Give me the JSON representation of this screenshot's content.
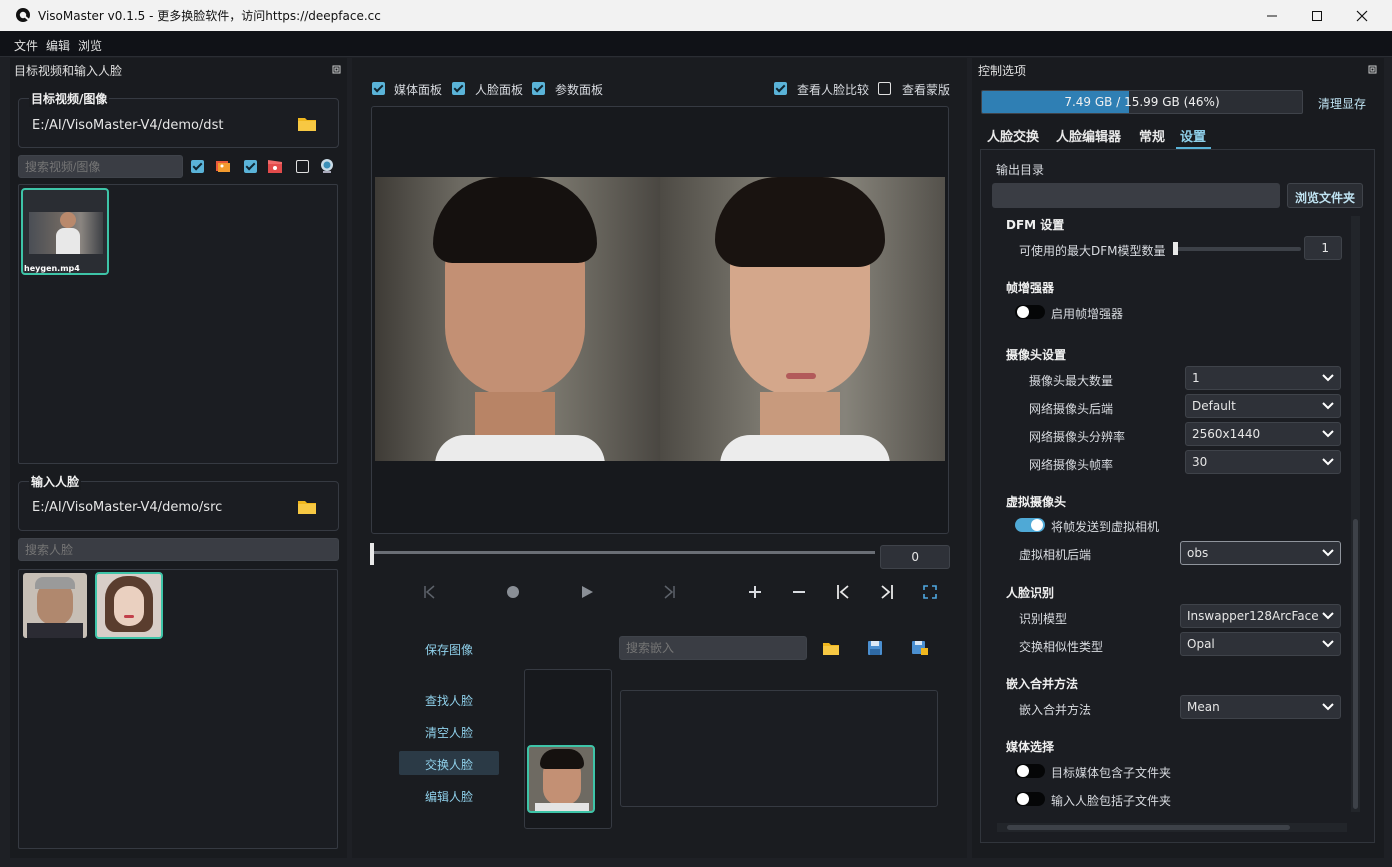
{
  "window": {
    "title": "VisoMaster v0.1.5 - 更多换脸软件，访问https://deepface.cc"
  },
  "menu": [
    "文件",
    "编辑",
    "浏览"
  ],
  "left_panel": {
    "header": "目标视频和输入人脸",
    "target": {
      "group_title": "目标视频/图像",
      "path": "E:/AI/VisoMaster-V4/demo/dst",
      "search_placeholder": "搜索视频/图像",
      "thumbs": [
        {
          "label": "heygen.mp4"
        }
      ]
    },
    "input": {
      "group_title": "输入人脸",
      "path": "E:/AI/VisoMaster-V4/demo/src",
      "search_placeholder": "搜索人脸"
    }
  },
  "center": {
    "checks": [
      {
        "label": "媒体面板",
        "checked": true
      },
      {
        "label": "人脸面板",
        "checked": true
      },
      {
        "label": "参数面板",
        "checked": true
      },
      {
        "label": "查看人脸比较",
        "checked": true
      },
      {
        "label": "查看蒙版",
        "checked": false
      }
    ],
    "frame_value": "0",
    "save_image": "保存图像",
    "embed_search_placeholder": "搜索嵌入",
    "face_buttons": [
      "查找人脸",
      "清空人脸",
      "交换人脸",
      "编辑人脸"
    ]
  },
  "right_panel": {
    "header": "控制选项",
    "memory": {
      "text": "7.49 GB / 15.99 GB (46%)",
      "fraction": 0.46,
      "clear_button": "清理显存"
    },
    "tabs": [
      "人脸交换",
      "人脸编辑器",
      "常规",
      "设置"
    ],
    "active_tab": "设置",
    "output": {
      "label": "输出目录",
      "browse_button": "浏览文件夹"
    },
    "dfm": {
      "title": "DFM 设置",
      "max_label": "可使用的最大DFM模型数量",
      "max_value": "1"
    },
    "frame_enhancer": {
      "title": "帧增强器",
      "toggle_label": "启用帧增强器",
      "on": false
    },
    "camera": {
      "title": "摄像头设置",
      "rows": [
        {
          "label": "摄像头最大数量",
          "value": "1"
        },
        {
          "label": "网络摄像头后端",
          "value": "Default"
        },
        {
          "label": "网络摄像头分辨率",
          "value": "2560x1440"
        },
        {
          "label": "网络摄像头帧率",
          "value": "30"
        }
      ]
    },
    "virtual_camera": {
      "title": "虚拟摄像头",
      "toggle_label": "将帧发送到虚拟相机",
      "on": true,
      "backend_label": "虚拟相机后端",
      "backend_value": "obs"
    },
    "recognition": {
      "title": "人脸识别",
      "rows": [
        {
          "label": "识别模型",
          "value": "Inswapper128ArcFace"
        },
        {
          "label": "交换相似性类型",
          "value": "Opal"
        }
      ]
    },
    "embed_merge": {
      "title": "嵌入合并方法",
      "label": "嵌入合并方法",
      "value": "Mean"
    },
    "media": {
      "title": "媒体选择",
      "toggles": [
        {
          "label": "目标媒体包含子文件夹",
          "on": false
        },
        {
          "label": "输入人脸包括子文件夹",
          "on": false
        }
      ]
    }
  },
  "colors": {
    "accent": "#3ec4a8",
    "memory_bar": "#2f7fb4",
    "link": "#8fd0ea",
    "toggle_on": "#4fa9d6"
  }
}
